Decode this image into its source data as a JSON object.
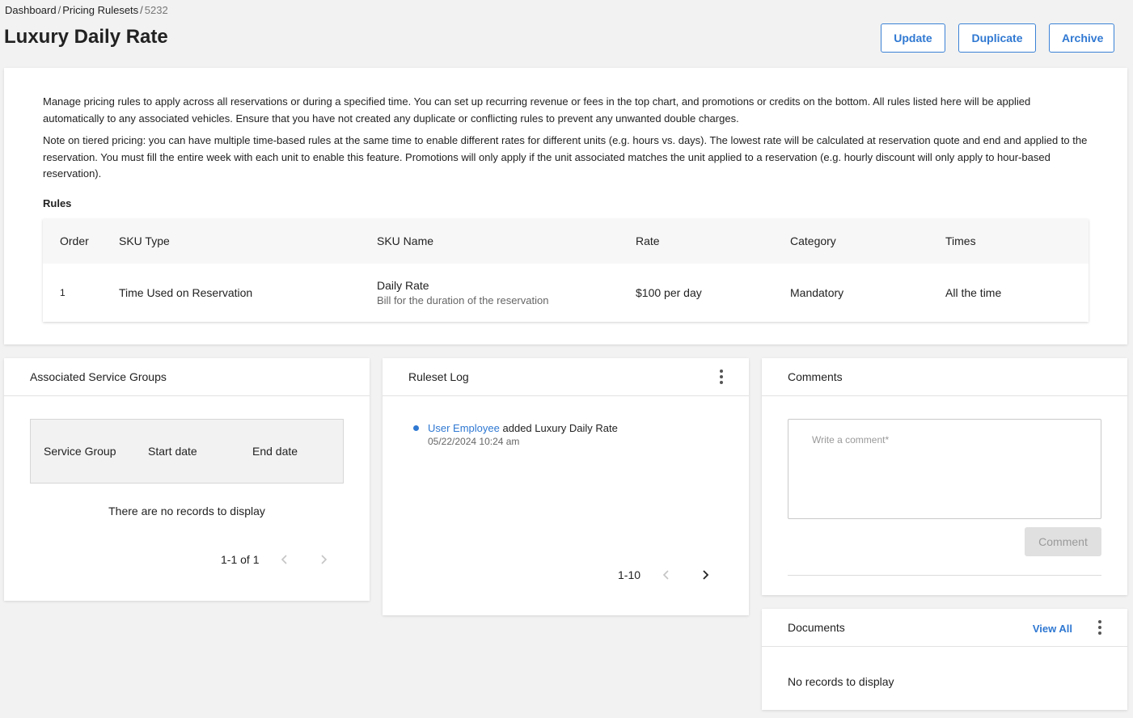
{
  "breadcrumb": {
    "items": [
      "Dashboard",
      "Pricing Rulesets"
    ],
    "current": "5232",
    "separator": "/"
  },
  "page": {
    "title": "Luxury Daily Rate"
  },
  "actions": {
    "update": "Update",
    "duplicate": "Duplicate",
    "archive": "Archive"
  },
  "description": {
    "p1": "Manage pricing rules to apply across all reservations or during a specified time. You can set up recurring revenue or fees in the top chart, and promotions or credits on the bottom. All rules listed here will be applied automatically to any associated vehicles. Ensure that you have not created any duplicate or conflicting rules to prevent any unwanted double charges.",
    "p2": "Note on tiered pricing: you can have multiple time-based rules at the same time to enable different rates for different units (e.g. hours vs. days). The lowest rate will be calculated at reservation quote and end and applied to the reservation. You must fill the entire week with each unit to enable this feature. Promotions will only apply if the unit associated matches the unit applied to a reservation (e.g. hourly discount will only apply to hour-based reservation)."
  },
  "rules": {
    "label": "Rules",
    "columns": [
      "Order",
      "SKU Type",
      "SKU Name",
      "Rate",
      "Category",
      "Times"
    ],
    "rows": [
      {
        "order": "1",
        "sku_type": "Time Used on Reservation",
        "sku_name": "Daily Rate",
        "sku_desc": "Bill for the duration of the reservation",
        "rate": "$100 per day",
        "category": "Mandatory",
        "times": "All the time"
      }
    ]
  },
  "service_groups": {
    "title": "Associated Service Groups",
    "columns": [
      "Service Group",
      "Start date",
      "End date"
    ],
    "empty": "There are no records to display",
    "pagination": "1-1 of 1"
  },
  "ruleset_log": {
    "title": "Ruleset Log",
    "entries": [
      {
        "user": "User Employee",
        "action": "added",
        "target": "Luxury Daily Rate",
        "time": "05/22/2024 10:24 am"
      }
    ],
    "pagination": "1-10"
  },
  "comments": {
    "title": "Comments",
    "placeholder": "Write a comment*",
    "value": "",
    "button": "Comment"
  },
  "documents": {
    "title": "Documents",
    "view_all": "View All",
    "empty": "No records to display"
  },
  "icons": {
    "kebab": "more-vertical-icon",
    "prev": "chevron-left-icon",
    "next": "chevron-right-icon"
  },
  "colors": {
    "accent": "#2f78d2",
    "background": "#f2f2f2",
    "card": "#ffffff",
    "disabled_button": "#e0e0e0"
  }
}
